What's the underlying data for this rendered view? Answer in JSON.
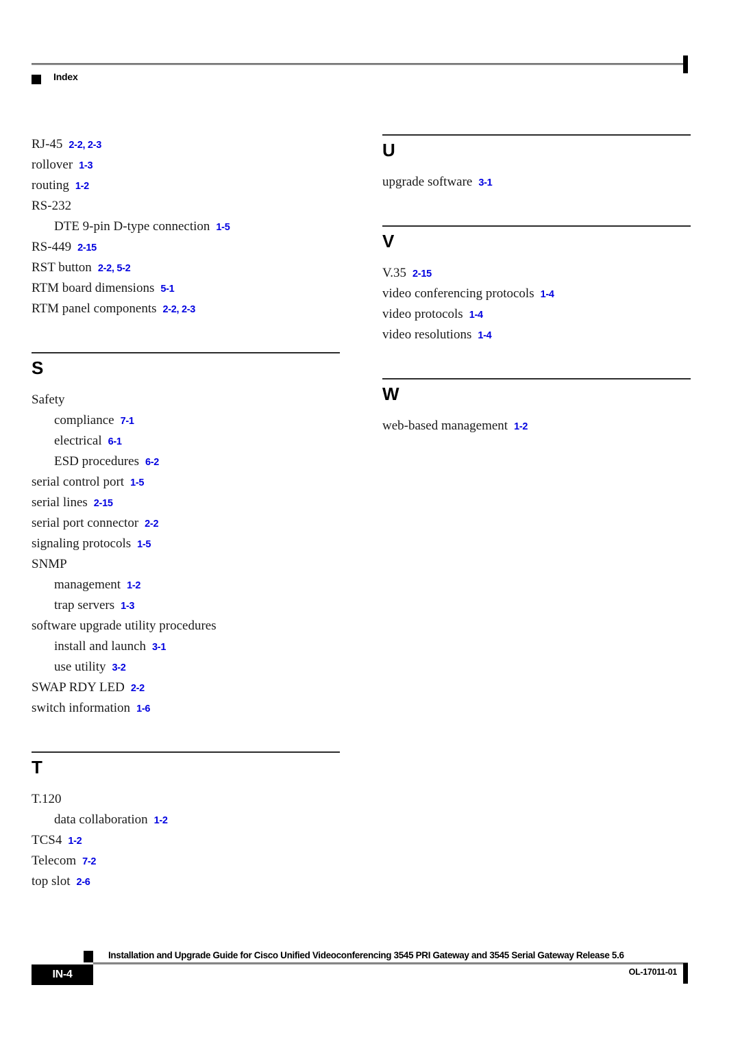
{
  "header": {
    "bullet_icon": "square-bullet-icon",
    "title": "Index"
  },
  "colors": {
    "page_number_link": "#0000e0",
    "rule": "#2b2b2b",
    "header_rule": "#8c8c8c"
  },
  "columns": {
    "left": {
      "sections": [
        {
          "letter": "",
          "has_rule": false,
          "entries": [
            {
              "term": "RJ-45",
              "pages": "2-2, 2-3",
              "level": 0
            },
            {
              "term": "rollover",
              "pages": "1-3",
              "level": 0
            },
            {
              "term": "routing",
              "pages": "1-2",
              "level": 0
            },
            {
              "term": "RS-232",
              "pages": "",
              "level": 0
            },
            {
              "term": "DTE 9-pin D-type connection",
              "pages": "1-5",
              "level": 1
            },
            {
              "term": "RS-449",
              "pages": "2-15",
              "level": 0
            },
            {
              "term": "RST button",
              "pages": "2-2, 5-2",
              "level": 0
            },
            {
              "term": "RTM board dimensions",
              "pages": "5-1",
              "level": 0
            },
            {
              "term": "RTM panel components",
              "pages": "2-2, 2-3",
              "level": 0
            }
          ]
        },
        {
          "letter": "S",
          "has_rule": true,
          "entries": [
            {
              "term": "Safety",
              "pages": "",
              "level": 0
            },
            {
              "term": "compliance",
              "pages": "7-1",
              "level": 1
            },
            {
              "term": "electrical",
              "pages": "6-1",
              "level": 1
            },
            {
              "term": "ESD procedures",
              "pages": "6-2",
              "level": 1
            },
            {
              "term": "serial control port",
              "pages": "1-5",
              "level": 0
            },
            {
              "term": "serial lines",
              "pages": "2-15",
              "level": 0
            },
            {
              "term": "serial port connector",
              "pages": "2-2",
              "level": 0
            },
            {
              "term": "signaling protocols",
              "pages": "1-5",
              "level": 0
            },
            {
              "term": "SNMP",
              "pages": "",
              "level": 0
            },
            {
              "term": "management",
              "pages": "1-2",
              "level": 1
            },
            {
              "term": "trap servers",
              "pages": "1-3",
              "level": 1
            },
            {
              "term": "software upgrade utility procedures",
              "pages": "",
              "level": 0
            },
            {
              "term": "install and launch",
              "pages": "3-1",
              "level": 1
            },
            {
              "term": "use utility",
              "pages": "3-2",
              "level": 1
            },
            {
              "term": "SWAP RDY LED",
              "pages": "2-2",
              "level": 0
            },
            {
              "term": "switch information",
              "pages": "1-6",
              "level": 0
            }
          ]
        },
        {
          "letter": "T",
          "has_rule": true,
          "entries": [
            {
              "term": "T.120",
              "pages": "",
              "level": 0
            },
            {
              "term": "data collaboration",
              "pages": "1-2",
              "level": 1
            },
            {
              "term": "TCS4",
              "pages": "1-2",
              "level": 0
            },
            {
              "term": "Telecom",
              "pages": "7-2",
              "level": 0
            },
            {
              "term": "top slot",
              "pages": "2-6",
              "level": 0
            }
          ]
        }
      ]
    },
    "right": {
      "sections": [
        {
          "letter": "U",
          "has_rule": true,
          "entries": [
            {
              "term": "upgrade software",
              "pages": "3-1",
              "level": 0
            }
          ]
        },
        {
          "letter": "V",
          "has_rule": true,
          "entries": [
            {
              "term": "V.35",
              "pages": "2-15",
              "level": 0
            },
            {
              "term": "video conferencing protocols",
              "pages": "1-4",
              "level": 0
            },
            {
              "term": "video protocols",
              "pages": "1-4",
              "level": 0
            },
            {
              "term": "video resolutions",
              "pages": "1-4",
              "level": 0
            }
          ]
        },
        {
          "letter": "W",
          "has_rule": true,
          "entries": [
            {
              "term": "web-based management",
              "pages": "1-2",
              "level": 0
            }
          ]
        }
      ]
    }
  },
  "footer": {
    "bullet_icon": "square-bullet-icon",
    "title": "Installation and Upgrade Guide for Cisco Unified Videoconferencing 3545 PRI Gateway and 3545 Serial Gateway Release 5.6",
    "page_number": "IN-4",
    "doc_id": "OL-17011-01"
  }
}
